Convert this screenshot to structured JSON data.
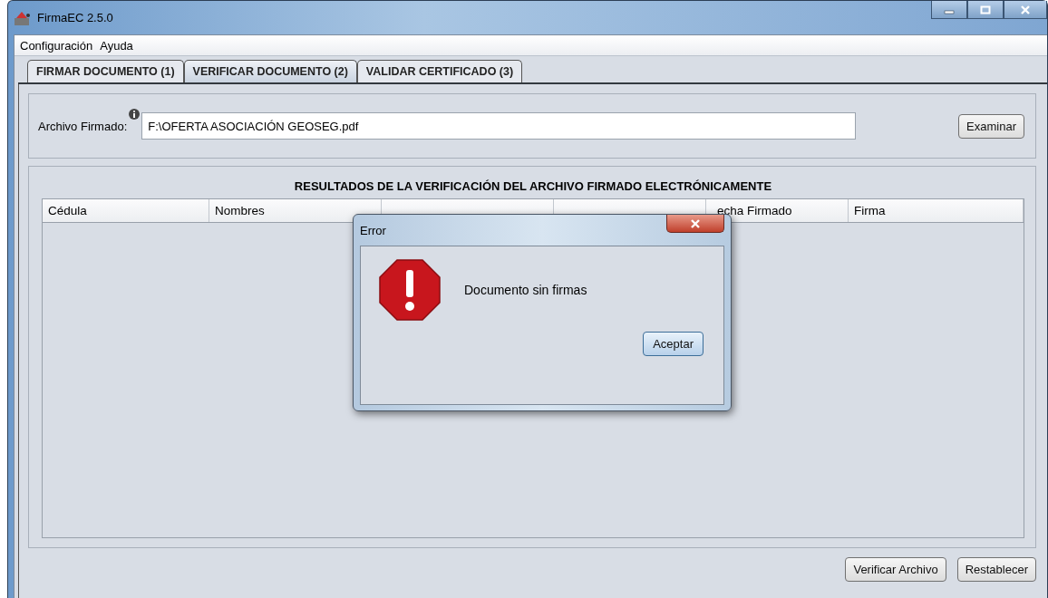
{
  "window": {
    "title": "FirmaEC 2.5.0"
  },
  "menu": [
    "Configuración",
    "Ayuda"
  ],
  "tabs": [
    {
      "label": "FIRMAR DOCUMENTO (1)",
      "selected": false
    },
    {
      "label": "VERIFICAR DOCUMENTO (2)",
      "selected": true
    },
    {
      "label": "VALIDAR CERTIFICADO (3)",
      "selected": false
    }
  ],
  "file_field": {
    "label": "Archivo Firmado:",
    "value": "F:\\OFERTA ASOCIACIÓN GEOSEG.pdf",
    "button": "Examinar"
  },
  "results": {
    "title": "RESULTADOS DE LA VERIFICACIÓN DEL ARCHIVO FIRMADO ELECTRÓNICAMENTE",
    "columns": [
      "Cédula",
      "Nombres",
      "",
      "",
      "echa Firmado",
      "Firma"
    ]
  },
  "buttons": [
    "Verificar Archivo",
    "Restablecer"
  ],
  "dialog": {
    "title": "Error",
    "message": "Documento sin firmas",
    "button": "Aceptar"
  }
}
